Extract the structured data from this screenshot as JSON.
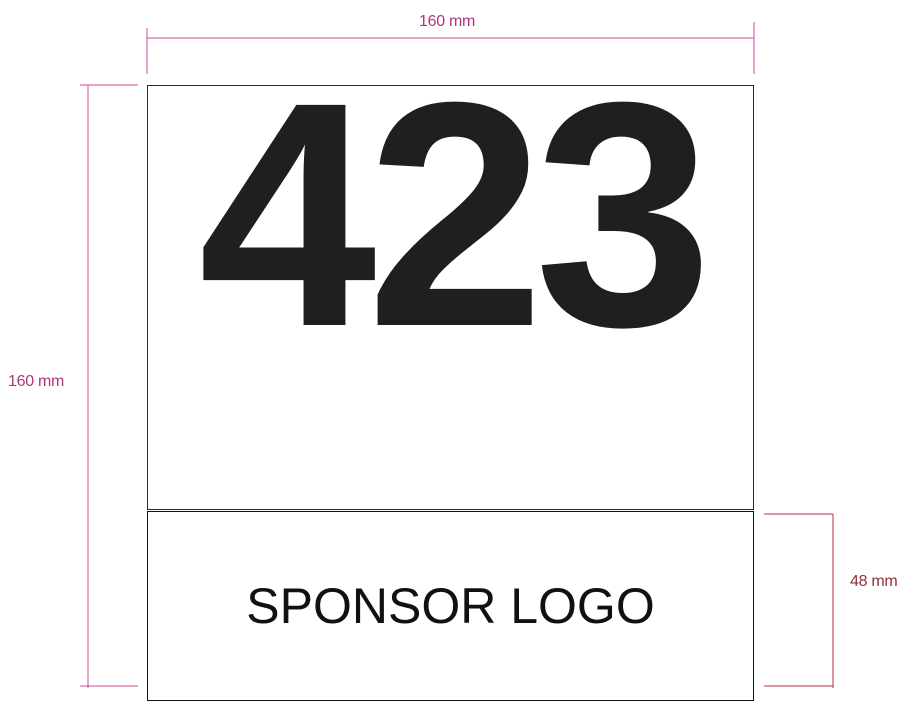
{
  "dimensions": {
    "width_label": "160 mm",
    "height_label": "160 mm",
    "sponsor_height_label": "48 mm"
  },
  "bib": {
    "number": "423"
  },
  "sponsor": {
    "label": "SPONSOR LOGO"
  },
  "colors": {
    "dimension_line": "#d64a9b",
    "dimension_text": "#b0357a",
    "sponsor_dimension_line": "#b5333e",
    "sponsor_dimension_text": "#8e2f38",
    "number_fill": "#1f1e21"
  }
}
